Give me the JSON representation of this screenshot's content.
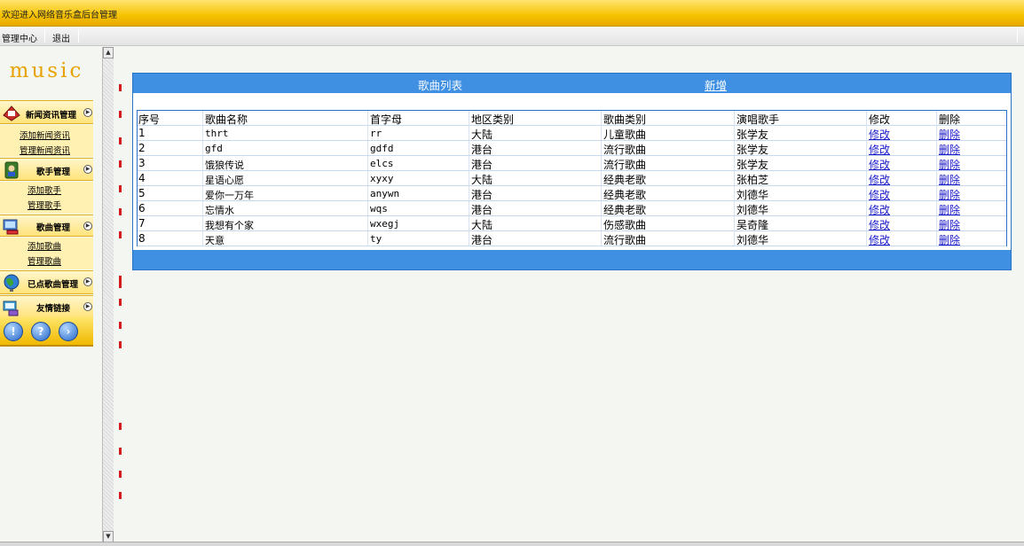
{
  "header": {
    "title": "欢迎进入网络音乐盒后台管理"
  },
  "menubar": {
    "items": [
      {
        "label": "管理中心"
      },
      {
        "label": "退出"
      }
    ]
  },
  "sidebar": {
    "logo": "music",
    "sections": [
      {
        "label": "新闻资讯管理",
        "icon": "news-icon",
        "links": [
          "添加新闻资讯",
          "管理新闻资讯"
        ]
      },
      {
        "label": "歌手管理",
        "icon": "singer-icon",
        "links": [
          "添加歌手",
          "管理歌手"
        ]
      },
      {
        "label": "歌曲管理",
        "icon": "song-icon",
        "links": [
          "添加歌曲",
          "管理歌曲"
        ]
      },
      {
        "label": "已点歌曲管理",
        "icon": "globe-icon",
        "links": []
      },
      {
        "label": "友情链接",
        "icon": "link-icon",
        "links": []
      }
    ],
    "icon_buttons": [
      {
        "icon": "info-icon",
        "glyph": "!"
      },
      {
        "icon": "help-icon",
        "glyph": "?"
      },
      {
        "icon": "forward-icon",
        "glyph": "›"
      }
    ]
  },
  "panel": {
    "title": "歌曲列表",
    "add_label": "新增",
    "columns": [
      "序号",
      "歌曲名称",
      "首字母",
      "地区类别",
      "歌曲类别",
      "演唱歌手",
      "修改",
      "删除"
    ],
    "rows": [
      {
        "id": "1",
        "name": "thrt",
        "initials": "rr",
        "region": "大陆",
        "category": "儿童歌曲",
        "singer": "张学友",
        "edit": "修改",
        "delete": "删除"
      },
      {
        "id": "2",
        "name": "gfd",
        "initials": "gdfd",
        "region": "港台",
        "category": "流行歌曲",
        "singer": "张学友",
        "edit": "修改",
        "delete": "删除"
      },
      {
        "id": "3",
        "name": "饿狼传说",
        "initials": "elcs",
        "region": "港台",
        "category": "流行歌曲",
        "singer": "张学友",
        "edit": "修改",
        "delete": "删除"
      },
      {
        "id": "4",
        "name": "星语心愿",
        "initials": "xyxy",
        "region": "大陆",
        "category": "经典老歌",
        "singer": "张柏芝",
        "edit": "修改",
        "delete": "删除"
      },
      {
        "id": "5",
        "name": "爱你一万年",
        "initials": "anywn",
        "region": "港台",
        "category": "经典老歌",
        "singer": "刘德华",
        "edit": "修改",
        "delete": "删除"
      },
      {
        "id": "6",
        "name": "忘情水",
        "initials": "wqs",
        "region": "港台",
        "category": "经典老歌",
        "singer": "刘德华",
        "edit": "修改",
        "delete": "删除"
      },
      {
        "id": "7",
        "name": "我想有个家",
        "initials": "wxegj",
        "region": "大陆",
        "category": "伤感歌曲",
        "singer": "吴奇隆",
        "edit": "修改",
        "delete": "删除"
      },
      {
        "id": "8",
        "name": "天意",
        "initials": "ty",
        "region": "港台",
        "category": "流行歌曲",
        "singer": "刘德华",
        "edit": "修改",
        "delete": "删除"
      }
    ]
  },
  "colors": {
    "header_gold": "#f6c200",
    "panel_blue": "#3f90e2",
    "link_blue": "#1a1ac9",
    "logo_orange": "#e8a200"
  }
}
